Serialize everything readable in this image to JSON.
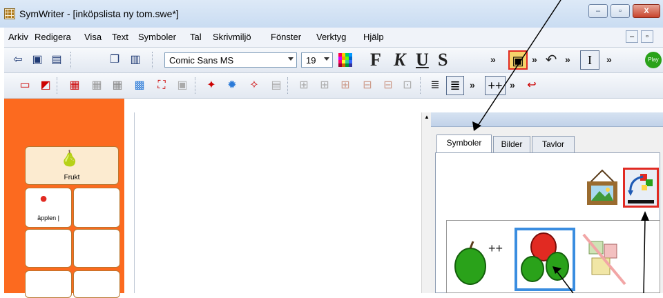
{
  "window": {
    "title": "SymWriter - [inköpslista ny tom.swe*]",
    "minimize_glyph": "–",
    "maximize_glyph": "▫",
    "close_glyph": "X"
  },
  "menu": {
    "items": [
      "Arkiv",
      "Redigera",
      "Visa",
      "Text",
      "Symboler",
      "Tal",
      "Skrivmiljö",
      "Fönster",
      "Verktyg",
      "Hjälp"
    ]
  },
  "toolbar": {
    "font_name": "Comic Sans MS",
    "font_size": "19",
    "bold_label": "F",
    "italic_label": "K",
    "underline_label": "U",
    "strike_label": "S",
    "play_label": "Play",
    "more_glyph": "»"
  },
  "grid": {
    "cell1_label": "Frukt",
    "cell2_label": "äpplen |"
  },
  "panel": {
    "tabs": [
      "Symboler",
      "Bilder",
      "Tavlor"
    ],
    "active_tab": "Symboler"
  },
  "colors": {
    "grid_panel": "#fc6a1f",
    "selection": "#3a8de0",
    "accent_red": "#e12a22",
    "apple_green": "#2aa21a"
  },
  "icons": {
    "picture_button": "framed-picture-icon",
    "switch_button": "symbol-swap-icon"
  }
}
